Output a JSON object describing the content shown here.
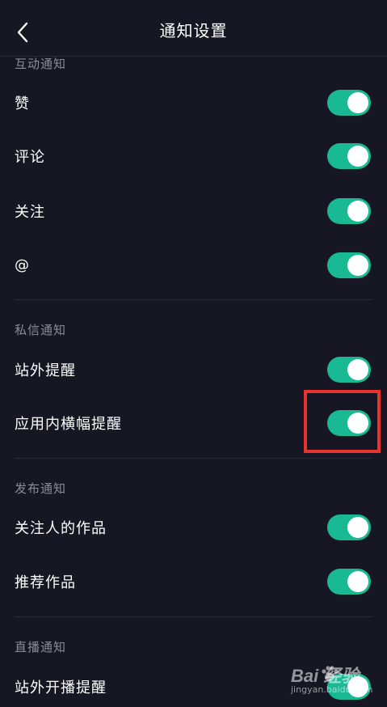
{
  "header": {
    "title": "通知设置",
    "back_icon": "chevron-left-icon"
  },
  "sections": [
    {
      "title": "互动通知",
      "items": [
        {
          "label": "赞",
          "enabled": true
        },
        {
          "label": "评论",
          "enabled": true
        },
        {
          "label": "关注",
          "enabled": true
        },
        {
          "label": "@",
          "enabled": true
        }
      ]
    },
    {
      "title": "私信通知",
      "items": [
        {
          "label": "站外提醒",
          "enabled": true
        },
        {
          "label": "应用内横幅提醒",
          "enabled": true
        }
      ]
    },
    {
      "title": "发布通知",
      "items": [
        {
          "label": "关注人的作品",
          "enabled": true
        },
        {
          "label": "推荐作品",
          "enabled": true
        }
      ]
    },
    {
      "title": "直播通知",
      "items": [
        {
          "label": "站外开播提醒",
          "enabled": true
        }
      ]
    }
  ],
  "colors": {
    "background": "#161722",
    "toggle_on": "#19b994",
    "section_title": "#8b8c96",
    "highlight": "#e8342e"
  },
  "watermark": {
    "text": "Bai 经验",
    "subtext": "jingyan.baidu.com"
  }
}
